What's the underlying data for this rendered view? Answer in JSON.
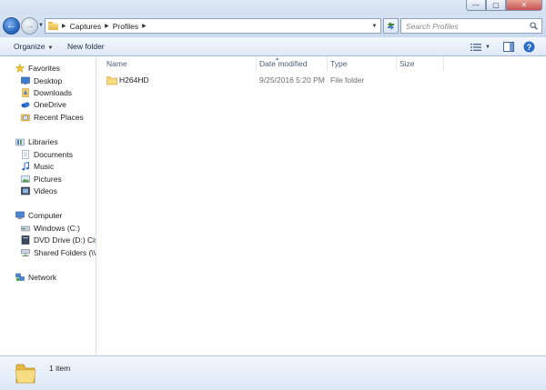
{
  "window": {
    "minimize_glyph": "—",
    "maximize_glyph": "▢",
    "close_glyph": "✕"
  },
  "nav": {
    "back_glyph": "←",
    "forward_glyph": "→",
    "breadcrumbs": [
      "Captures",
      "Profiles"
    ],
    "search_placeholder": "Search Profiles"
  },
  "commandbar": {
    "organize_label": "Organize",
    "new_folder_label": "New folder"
  },
  "sidebar": {
    "favorites": {
      "label": "Favorites",
      "items": [
        {
          "label": "Desktop",
          "icon": "desktop-icon"
        },
        {
          "label": "Downloads",
          "icon": "downloads-icon"
        },
        {
          "label": "OneDrive",
          "icon": "onedrive-icon"
        },
        {
          "label": "Recent Places",
          "icon": "recent-places-icon"
        }
      ]
    },
    "libraries": {
      "label": "Libraries",
      "items": [
        {
          "label": "Documents",
          "icon": "documents-icon"
        },
        {
          "label": "Music",
          "icon": "music-icon"
        },
        {
          "label": "Pictures",
          "icon": "pictures-icon"
        },
        {
          "label": "Videos",
          "icon": "videos-icon"
        }
      ]
    },
    "computer": {
      "label": "Computer",
      "items": [
        {
          "label": "Windows (C:)",
          "icon": "drive-icon"
        },
        {
          "label": "DVD Drive (D:) Cisco",
          "icon": "dvd-drive-icon"
        },
        {
          "label": "Shared Folders (\\\\vn",
          "icon": "network-drive-icon"
        }
      ]
    },
    "network": {
      "label": "Network"
    }
  },
  "columns": {
    "name": "Name",
    "date_modified": "Date modified",
    "type": "Type",
    "size": "Size"
  },
  "files": [
    {
      "name": "H264HD",
      "date_modified": "9/25/2016 5:20 PM",
      "type": "File folder",
      "size": ""
    }
  ],
  "status": {
    "item_count": "1 item"
  },
  "colors": {
    "folder_yellow": "#f2cf6a",
    "nav_blue": "#1f5fb8"
  }
}
